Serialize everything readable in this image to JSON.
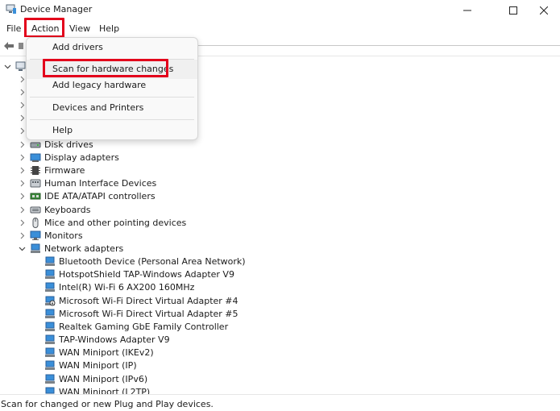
{
  "window": {
    "title": "Device Manager",
    "icons": {
      "app": "device-manager-icon",
      "minimize": "minimize-icon",
      "maximize": "maximize-icon",
      "close": "close-icon"
    }
  },
  "menubar": {
    "file": "File",
    "action": "Action",
    "view": "View",
    "help": "Help"
  },
  "colors": {
    "highlight_border": "#e3001b",
    "monitor_blue": "#3a8fd9",
    "text": "#1b1b1b"
  },
  "tree": {
    "root_icon": "computer-icon",
    "categories": [
      {
        "label": "Disk drives",
        "icon": "disk-drive-icon"
      },
      {
        "label": "Display adapters",
        "icon": "display-adapter-icon"
      },
      {
        "label": "Firmware",
        "icon": "firmware-icon"
      },
      {
        "label": "Human Interface Devices",
        "icon": "hid-icon"
      },
      {
        "label": "IDE ATA/ATAPI controllers",
        "icon": "ide-controller-icon"
      },
      {
        "label": "Keyboards",
        "icon": "keyboard-icon"
      },
      {
        "label": "Mice and other pointing devices",
        "icon": "mouse-icon"
      },
      {
        "label": "Monitors",
        "icon": "monitor-icon"
      },
      {
        "label": "Network adapters",
        "icon": "network-adapter-icon"
      }
    ],
    "network_children": [
      "Bluetooth Device (Personal Area Network)",
      "HotspotShield TAP-Windows Adapter V9",
      "Intel(R) Wi-Fi 6 AX200 160MHz",
      "Microsoft Wi-Fi Direct Virtual Adapter #4",
      "Microsoft Wi-Fi Direct Virtual Adapter #5",
      "Realtek Gaming GbE Family Controller",
      "TAP-Windows Adapter V9",
      "WAN Miniport (IKEv2)",
      "WAN Miniport (IP)",
      "WAN Miniport (IPv6)",
      "WAN Miniport (L2TP)"
    ]
  },
  "action_menu": {
    "add_drivers": "Add drivers",
    "scan": "Scan for hardware changes",
    "add_legacy": "Add legacy hardware",
    "devices_printers": "Devices and Printers",
    "help": "Help"
  },
  "statusbar": {
    "text": "Scan for changed or new Plug and Play devices."
  }
}
